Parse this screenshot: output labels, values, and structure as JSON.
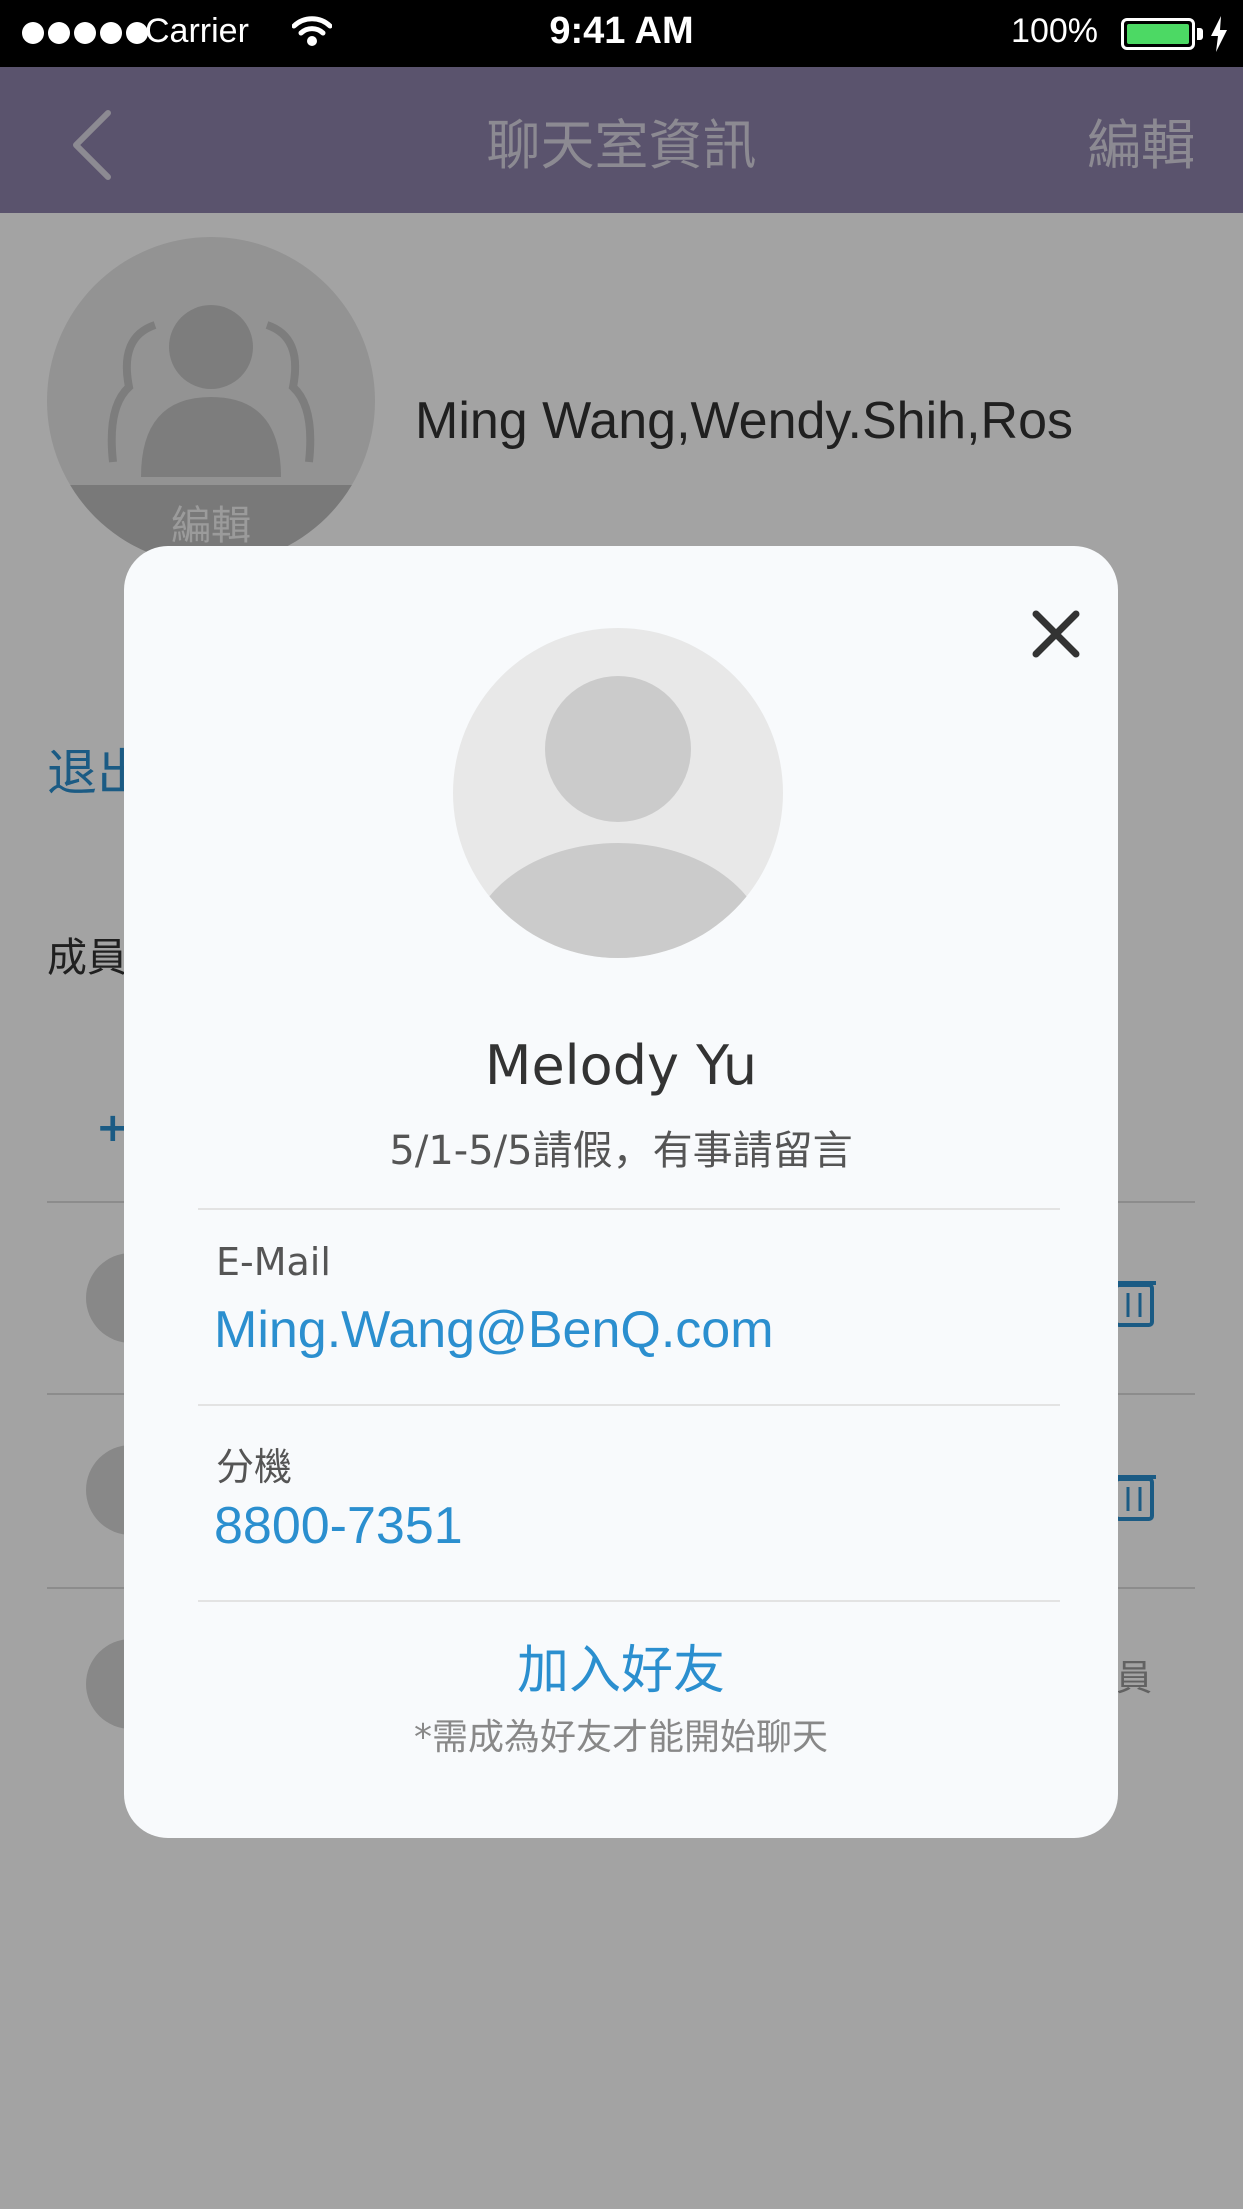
{
  "status_bar": {
    "carrier": "Carrier",
    "time": "9:41 AM",
    "battery": "100%"
  },
  "nav": {
    "title": "聊天室資訊",
    "edit": "編輯"
  },
  "group": {
    "avatar_edit": "編輯",
    "name": "Ming Wang,Wendy.Shih,Ros",
    "leave": "退出",
    "members_label": "成員",
    "member_role_partial": "員"
  },
  "profile": {
    "name": "Melody Yu",
    "status": "5/1-5/5請假，有事請留言",
    "email_label": "E-Mail",
    "email": "Ming.Wang@BenQ.com",
    "ext_label": "分機",
    "ext": "8800-7351",
    "add_friend": "加入好友",
    "note": "*需成為好友才能開始聊天"
  },
  "colors": {
    "nav_bg": "#8e82ab",
    "accent": "#2b8fcf",
    "overlay": "rgba(0,0,0,0.36)"
  }
}
